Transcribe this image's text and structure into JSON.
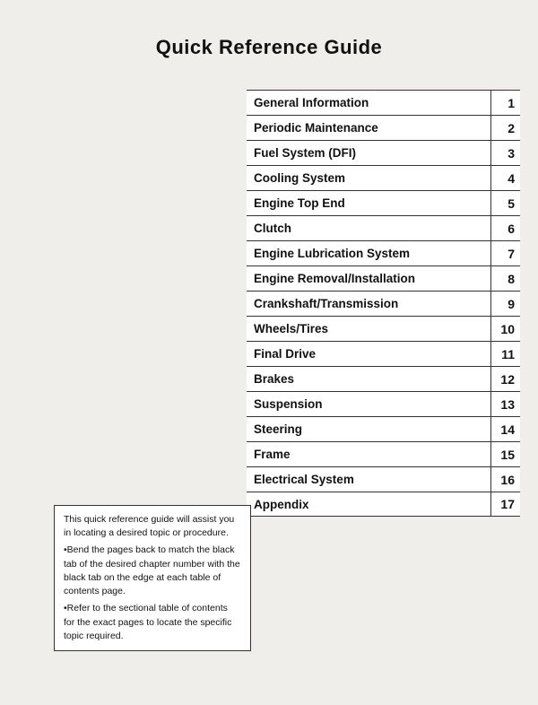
{
  "page": {
    "title": "Quick Reference Guide",
    "toc": [
      {
        "label": "General Information",
        "number": "1"
      },
      {
        "label": "Periodic Maintenance",
        "number": "2"
      },
      {
        "label": "Fuel System (DFI)",
        "number": "3"
      },
      {
        "label": "Cooling System",
        "number": "4"
      },
      {
        "label": "Engine Top End",
        "number": "5"
      },
      {
        "label": "Clutch",
        "number": "6"
      },
      {
        "label": "Engine Lubrication System",
        "number": "7"
      },
      {
        "label": "Engine Removal/Installation",
        "number": "8"
      },
      {
        "label": "Crankshaft/Transmission",
        "number": "9"
      },
      {
        "label": "Wheels/Tires",
        "number": "10"
      },
      {
        "label": "Final Drive",
        "number": "11"
      },
      {
        "label": "Brakes",
        "number": "12"
      },
      {
        "label": "Suspension",
        "number": "13"
      },
      {
        "label": "Steering",
        "number": "14"
      },
      {
        "label": "Frame",
        "number": "15"
      },
      {
        "label": "Electrical System",
        "number": "16"
      },
      {
        "label": "Appendix",
        "number": "17"
      }
    ],
    "note": {
      "text": "This quick reference guide will assist you in locating a desired topic or procedure.\n•Bend the pages back to match the black tab of the desired chapter number with the black tab on the edge at each table of contents page.\n•Refer to the sectional table of contents for the exact pages to locate the specific topic required."
    }
  }
}
